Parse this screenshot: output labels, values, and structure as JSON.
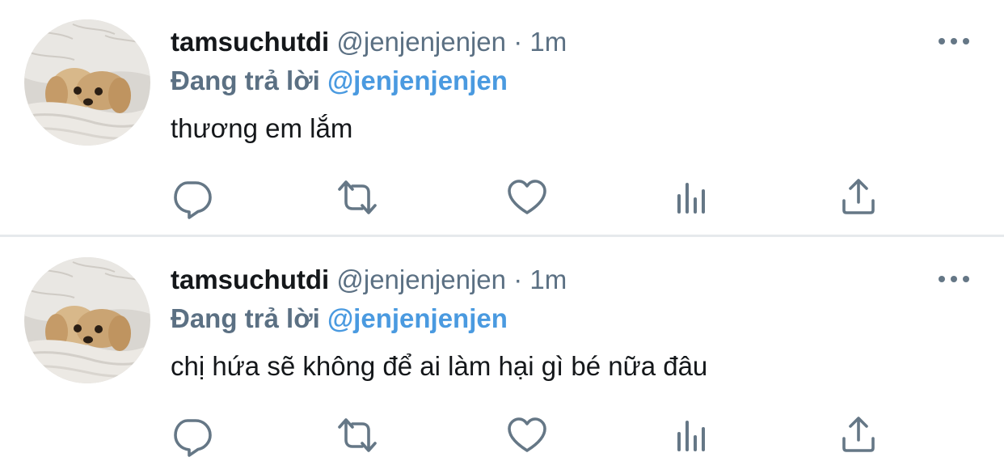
{
  "colors": {
    "text_primary": "#14171a",
    "text_secondary": "#5b7083",
    "mention": "#4a9ae0",
    "divider": "#e6e9ec",
    "icon": "#657786"
  },
  "tweets": [
    {
      "avatar_icon": "puppy-avatar",
      "display_name": "tamsuchutdi",
      "handle": "@jenjenjenjen",
      "separator": "·",
      "time": "1m",
      "reply_prefix": "Đang trả lời",
      "reply_to": "@jenjenjenjen",
      "text": "thương em lắm",
      "actions": [
        "reply-icon",
        "retweet-icon",
        "like-icon",
        "views-icon",
        "share-icon"
      ]
    },
    {
      "avatar_icon": "puppy-avatar",
      "display_name": "tamsuchutdi",
      "handle": "@jenjenjenjen",
      "separator": "·",
      "time": "1m",
      "reply_prefix": "Đang trả lời",
      "reply_to": "@jenjenjenjen",
      "text": "chị hứa sẽ không để ai làm hại gì bé nữa đâu",
      "actions": [
        "reply-icon",
        "retweet-icon",
        "like-icon",
        "views-icon",
        "share-icon"
      ]
    }
  ]
}
